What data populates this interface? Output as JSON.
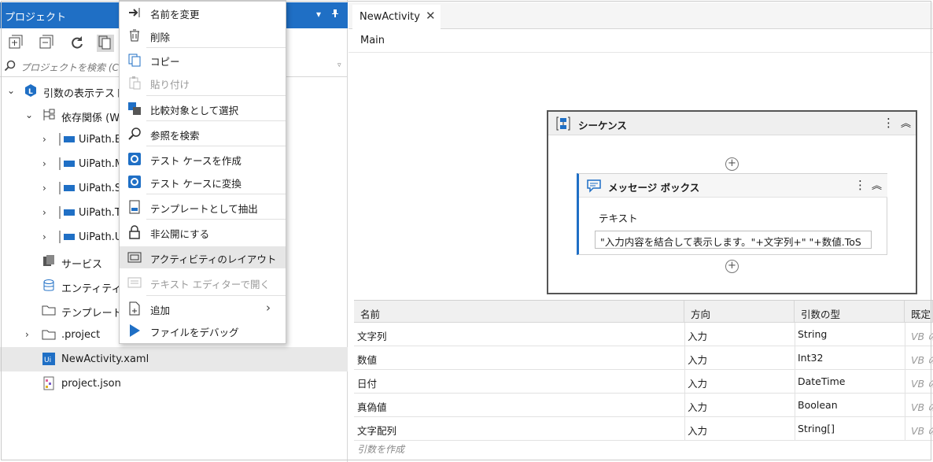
{
  "panel": {
    "title": "プロジェクト",
    "search_placeholder": "プロジェクトを検索 (Ct",
    "tree": [
      {
        "label": "引数の表示テスト",
        "icon": "project-icon"
      },
      {
        "label": "依存関係 (W",
        "icon": "dependency-icon"
      },
      {
        "label": "UiPath.E",
        "icon": "package-icon"
      },
      {
        "label": "UiPath.M",
        "icon": "package-icon"
      },
      {
        "label": "UiPath.S",
        "icon": "package-icon"
      },
      {
        "label": "UiPath.T",
        "icon": "package-icon"
      },
      {
        "label": "UiPath.U",
        "icon": "package-icon"
      },
      {
        "label": "サービス",
        "icon": "services-icon"
      },
      {
        "label": "エンティティ",
        "icon": "database-icon"
      },
      {
        "label": "テンプレート",
        "icon": "folder-icon"
      },
      {
        "label": ".project",
        "icon": "folder-icon"
      },
      {
        "label": "NewActivity.xaml",
        "icon": "xaml-file-icon"
      },
      {
        "label": "project.json",
        "icon": "json-file-icon"
      }
    ]
  },
  "context_menu": {
    "items": [
      {
        "label": "名前を変更",
        "icon": "rename-icon",
        "disabled": false
      },
      {
        "label": "削除",
        "icon": "trash-icon",
        "disabled": false
      },
      {
        "label": "コピー",
        "icon": "copy-icon",
        "disabled": false
      },
      {
        "label": "貼り付け",
        "icon": "paste-icon",
        "disabled": true
      },
      {
        "label": "比較対象として選択",
        "icon": "compare-icon",
        "disabled": false
      },
      {
        "label": "参照を検索",
        "icon": "search-icon",
        "disabled": false
      },
      {
        "label": "テスト ケースを作成",
        "icon": "test-case-icon",
        "disabled": false
      },
      {
        "label": "テスト ケースに変換",
        "icon": "test-convert-icon",
        "disabled": false
      },
      {
        "label": "テンプレートとして抽出",
        "icon": "template-icon",
        "disabled": false
      },
      {
        "label": "非公開にする",
        "icon": "lock-icon",
        "disabled": false
      },
      {
        "label": "アクティビティのレイアウト",
        "icon": "layout-icon",
        "disabled": false
      },
      {
        "label": "テキスト エディターで開く",
        "icon": "text-editor-icon",
        "disabled": true
      },
      {
        "label": "追加",
        "icon": "add-file-icon",
        "disabled": false
      },
      {
        "label": "ファイルをデバッグ",
        "icon": "play-icon",
        "disabled": false
      }
    ]
  },
  "designer": {
    "tab": "NewActivity",
    "breadcrumb": "Main",
    "sequence_title": "シーケンス",
    "message_box_title": "メッセージ ボックス",
    "field_label": "テキスト",
    "field_value": "\"入力内容を結合して表示します。\"+文字列+\" \"+数値.ToS"
  },
  "arguments": {
    "headers": [
      "名前",
      "方向",
      "引数の型",
      "既定"
    ],
    "rows": [
      [
        "文字列",
        "入力",
        "String",
        "VB の"
      ],
      [
        "数値",
        "入力",
        "Int32",
        "VB の"
      ],
      [
        "日付",
        "入力",
        "DateTime",
        "VB の"
      ],
      [
        "真偽値",
        "入力",
        "Boolean",
        "VB の"
      ],
      [
        "文字配列",
        "入力",
        "String[]",
        "VB の"
      ]
    ],
    "create_label": "引数を作成"
  },
  "colors": {
    "accent": "#1f6fc5",
    "selection": "#e8e8e8"
  }
}
